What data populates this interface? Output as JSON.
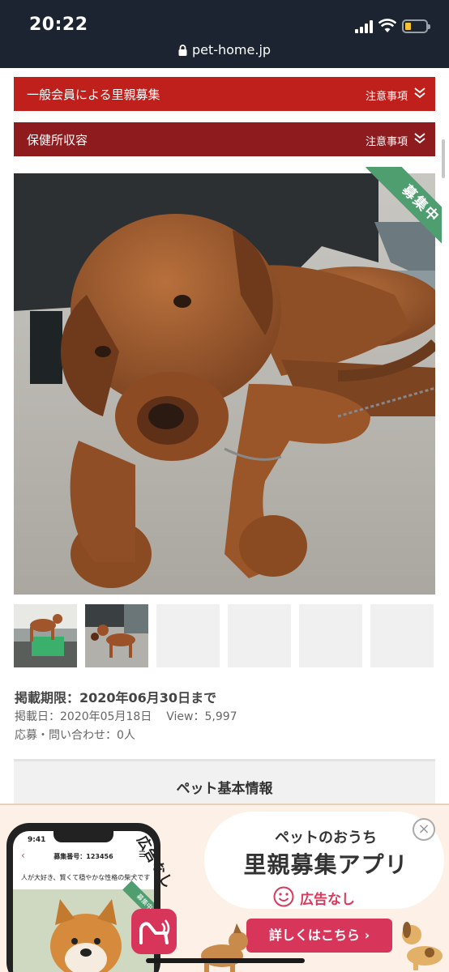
{
  "status_bar": {
    "time": "20:22",
    "url": "pet-home.jp",
    "battery_color": "#f2c230"
  },
  "banners": [
    {
      "title": "一般会員による里親募集",
      "note": "注意事項",
      "color": "#c0201c"
    },
    {
      "title": "保健所収容",
      "note": "注意事項",
      "color": "#8e1c1f"
    }
  ],
  "main_photo": {
    "ribbon": "募集中"
  },
  "listing": {
    "deadline": "掲載期限：2020年06月30日まで",
    "posted": "掲載日：2020年05月18日",
    "views": "View：5,997",
    "inquiries": "応募・問い合わせ：0人"
  },
  "section": {
    "basic_info": "ペット基本情報"
  },
  "ad": {
    "tag": "広告なし",
    "title_line1": "ペットのおうち",
    "title_line2": "里親募集アプリ",
    "no_ads": "広告なし",
    "cta": "詳しくはこちら ›",
    "close": "×",
    "phone": {
      "time": "9:41",
      "number": "募集番号：123456",
      "desc": "人が大好き、賢くて穏やかな性格の柴犬です",
      "ribbon": "募集中"
    }
  }
}
